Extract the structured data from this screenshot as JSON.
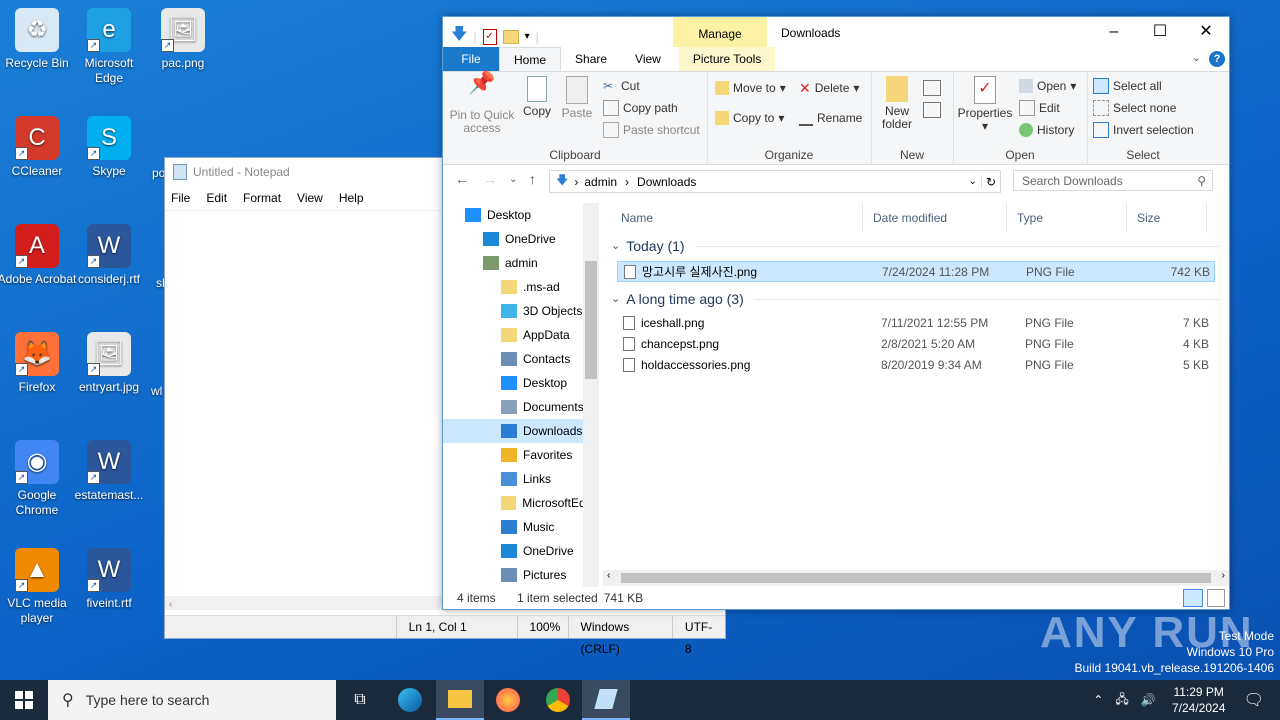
{
  "desktop": {
    "icons": [
      {
        "label": "Recycle Bin",
        "color": "#d8e8f5"
      },
      {
        "label": "Microsoft Edge",
        "color": "#1da0e4"
      },
      {
        "label": "pac.png",
        "color": "#e8e8e8"
      },
      {
        "label": "CCleaner",
        "color": "#d33a2c"
      },
      {
        "label": "Skype",
        "color": "#00aff0"
      },
      {
        "label": "Adobe Acrobat",
        "color": "#d41e1e"
      },
      {
        "label": "considerj.rtf",
        "color": "#2b579a"
      },
      {
        "label": "Firefox",
        "color": "#ff7139"
      },
      {
        "label": "entryart.jpg",
        "color": "#e8e8e8"
      },
      {
        "label": "Google Chrome",
        "color": "#4285f4"
      },
      {
        "label": "estatemast...",
        "color": "#2b579a"
      },
      {
        "label": "VLC media player",
        "color": "#f08a00"
      },
      {
        "label": "fiveint.rtf",
        "color": "#2b579a"
      }
    ],
    "partial_labels": [
      "po",
      "sl",
      "wl"
    ]
  },
  "notepad": {
    "title": "Untitled - Notepad",
    "menu": [
      "File",
      "Edit",
      "Format",
      "View",
      "Help"
    ],
    "status": {
      "position": "Ln 1, Col 1",
      "zoom": "100%",
      "line_ending": "Windows (CRLF)",
      "encoding": "UTF-8"
    }
  },
  "explorer": {
    "title": "Downloads",
    "context_tab": "Manage",
    "tabs": [
      "File",
      "Home",
      "Share",
      "View",
      "Picture Tools"
    ],
    "ribbon": {
      "clipboard": {
        "label": "Clipboard",
        "pin": "Pin to Quick access",
        "copy": "Copy",
        "paste": "Paste",
        "cut": "Cut",
        "copy_path": "Copy path",
        "paste_shortcut": "Paste shortcut"
      },
      "organize": {
        "label": "Organize",
        "move_to": "Move to",
        "copy_to": "Copy to",
        "delete": "Delete",
        "rename": "Rename"
      },
      "new": {
        "label": "New",
        "new_folder": "New folder"
      },
      "open": {
        "label": "Open",
        "properties": "Properties",
        "open": "Open",
        "edit": "Edit",
        "history": "History"
      },
      "select": {
        "label": "Select",
        "select_all": "Select all",
        "select_none": "Select none",
        "invert": "Invert selection"
      }
    },
    "address": {
      "crumbs": [
        "admin",
        "Downloads"
      ],
      "search_placeholder": "Search Downloads"
    },
    "nav": [
      {
        "label": "Desktop",
        "indent": 0,
        "color": "#1e90ff"
      },
      {
        "label": "OneDrive",
        "indent": 1,
        "color": "#1e88d8"
      },
      {
        "label": "admin",
        "indent": 1,
        "color": "#7a9a6a"
      },
      {
        "label": ".ms-ad",
        "indent": 2,
        "color": "#f5d77a"
      },
      {
        "label": "3D Objects",
        "indent": 2,
        "color": "#3fb5e8"
      },
      {
        "label": "AppData",
        "indent": 2,
        "color": "#f5d77a"
      },
      {
        "label": "Contacts",
        "indent": 2,
        "color": "#6a8fb5"
      },
      {
        "label": "Desktop",
        "indent": 2,
        "color": "#1e90ff"
      },
      {
        "label": "Documents",
        "indent": 2,
        "color": "#8aa0b8"
      },
      {
        "label": "Downloads",
        "indent": 2,
        "color": "#2a7fd4",
        "selected": true
      },
      {
        "label": "Favorites",
        "indent": 2,
        "color": "#f0b429"
      },
      {
        "label": "Links",
        "indent": 2,
        "color": "#4a90d9"
      },
      {
        "label": "MicrosoftEdge",
        "indent": 2,
        "color": "#f5d77a"
      },
      {
        "label": "Music",
        "indent": 2,
        "color": "#2a7fd4"
      },
      {
        "label": "OneDrive",
        "indent": 2,
        "color": "#1e88d8"
      },
      {
        "label": "Pictures",
        "indent": 2,
        "color": "#6a8fb5"
      }
    ],
    "columns": [
      "Name",
      "Date modified",
      "Type",
      "Size"
    ],
    "groups": [
      {
        "header": "Today (1)",
        "files": [
          {
            "name": "망고시루 실제사진.png",
            "date": "7/24/2024 11:28 PM",
            "type": "PNG File",
            "size": "742 KB",
            "selected": true
          }
        ]
      },
      {
        "header": "A long time ago (3)",
        "files": [
          {
            "name": "iceshall.png",
            "date": "7/11/2021 12:55 PM",
            "type": "PNG File",
            "size": "7 KB"
          },
          {
            "name": "chancepst.png",
            "date": "2/8/2021 5:20 AM",
            "type": "PNG File",
            "size": "4 KB"
          },
          {
            "name": "holdaccessories.png",
            "date": "8/20/2019 9:34 AM",
            "type": "PNG File",
            "size": "5 KB"
          }
        ]
      }
    ],
    "status": {
      "items": "4 items",
      "selected": "1 item selected",
      "size": "741 KB"
    }
  },
  "taskbar": {
    "search_placeholder": "Type here to search",
    "time": "11:29 PM",
    "date": "7/24/2024"
  },
  "watermark": {
    "brand": "ANY RUN",
    "line1": "Test Mode",
    "line2": "Windows 10 Pro",
    "line3": "Build 19041.vb_release.191206-1406"
  }
}
